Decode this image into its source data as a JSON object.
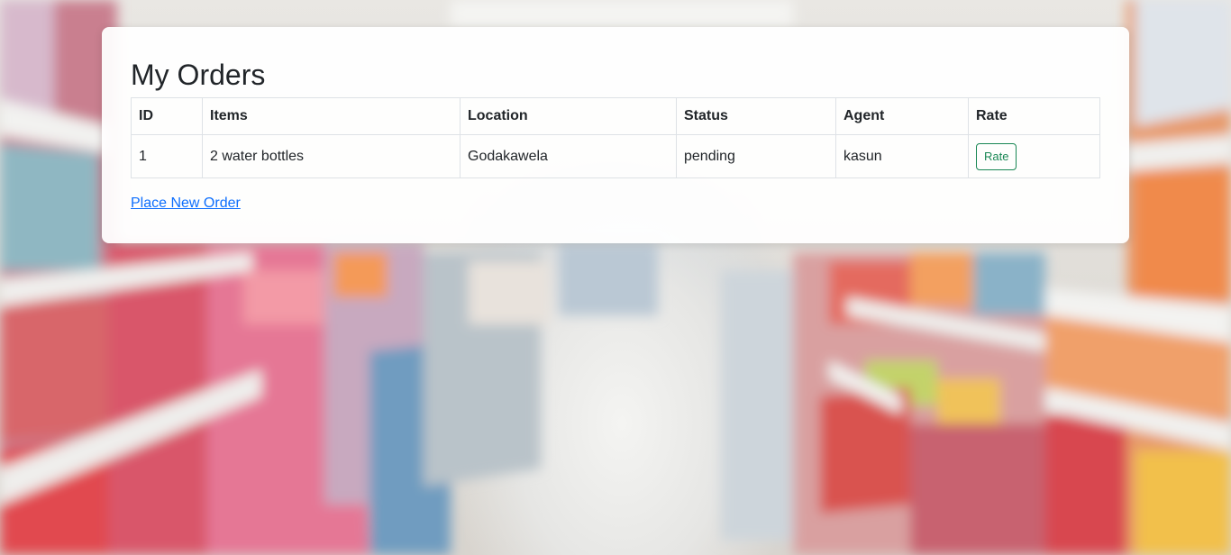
{
  "page": {
    "title": "My Orders",
    "new_order_link": "Place New Order"
  },
  "table": {
    "headers": [
      "ID",
      "Items",
      "Location",
      "Status",
      "Agent",
      "Rate"
    ],
    "rows": [
      {
        "id": "1",
        "items": "2 water bottles",
        "location": "Godakawela",
        "status": "pending",
        "agent": "kasun",
        "rate_label": "Rate"
      }
    ]
  },
  "colors": {
    "rate_button": "#198754",
    "link": "#0d6efd",
    "text": "#212529"
  }
}
